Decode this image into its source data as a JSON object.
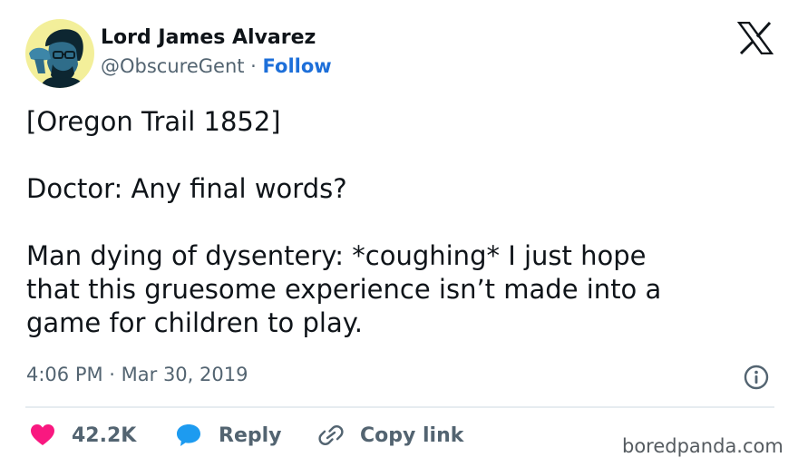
{
  "author": {
    "display_name": "Lord James Alvarez",
    "handle": "@ObscureGent",
    "separator": "·",
    "follow_label": "Follow",
    "avatar_icon": "profile-photo"
  },
  "platform": {
    "logo_icon": "x-logo"
  },
  "tweet": {
    "paragraphs": [
      "[Oregon Trail 1852]",
      "Doctor: Any final words?",
      "Man dying of dysentery: *coughing* I just hope\nthat this gruesome experience isn’t made into a\ngame for children to play."
    ],
    "timestamp": "4:06 PM · Mar 30, 2019"
  },
  "actions": {
    "like_count": "42.2K",
    "reply_label": "Reply",
    "copy_link_label": "Copy link"
  },
  "colors": {
    "like": "#f91880",
    "reply": "#1d9bf0",
    "follow": "#1d6fd9",
    "muted": "#536471",
    "text": "#0f1419",
    "avatar_bg": "#f3ef9a"
  },
  "watermark": "boredpanda.com"
}
